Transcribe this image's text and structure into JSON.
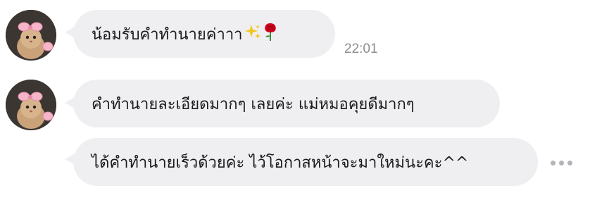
{
  "messages": [
    {
      "text": "น้อมรับคำทำนายค่าาา",
      "time": "22:01",
      "emojis": [
        "sparkles-icon",
        "rose-icon"
      ]
    },
    {
      "text": "คำทำนายละเอียดมากๆ เลยค่ะ แม่หมอคุยดีมากๆ"
    },
    {
      "text": "ได้คำทำนายเร็วด้วยค่ะ ไว้โอกาสหน้าจะมาใหม่นะคะ^^"
    }
  ],
  "colors": {
    "bubble": "#efeff2",
    "text": "#1b1b1b",
    "time": "#8e8e93"
  }
}
